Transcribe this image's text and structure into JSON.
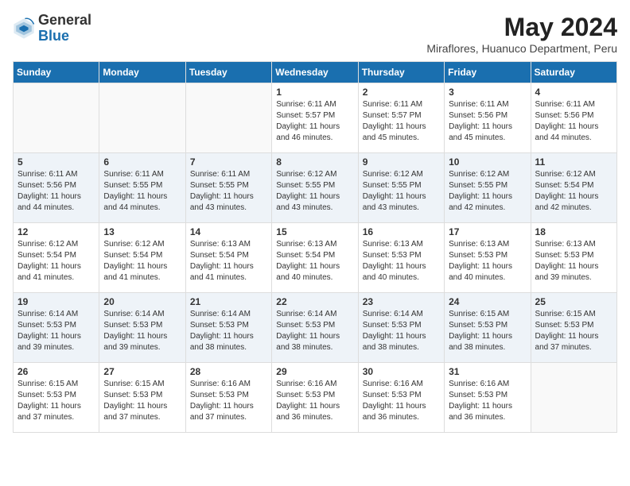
{
  "header": {
    "logo_general": "General",
    "logo_blue": "Blue",
    "month_year": "May 2024",
    "location": "Miraflores, Huanuco Department, Peru"
  },
  "days_of_week": [
    "Sunday",
    "Monday",
    "Tuesday",
    "Wednesday",
    "Thursday",
    "Friday",
    "Saturday"
  ],
  "weeks": [
    [
      {
        "day": "",
        "sunrise": "",
        "sunset": "",
        "daylight": ""
      },
      {
        "day": "",
        "sunrise": "",
        "sunset": "",
        "daylight": ""
      },
      {
        "day": "",
        "sunrise": "",
        "sunset": "",
        "daylight": ""
      },
      {
        "day": "1",
        "sunrise": "Sunrise: 6:11 AM",
        "sunset": "Sunset: 5:57 PM",
        "daylight": "Daylight: 11 hours and 46 minutes."
      },
      {
        "day": "2",
        "sunrise": "Sunrise: 6:11 AM",
        "sunset": "Sunset: 5:57 PM",
        "daylight": "Daylight: 11 hours and 45 minutes."
      },
      {
        "day": "3",
        "sunrise": "Sunrise: 6:11 AM",
        "sunset": "Sunset: 5:56 PM",
        "daylight": "Daylight: 11 hours and 45 minutes."
      },
      {
        "day": "4",
        "sunrise": "Sunrise: 6:11 AM",
        "sunset": "Sunset: 5:56 PM",
        "daylight": "Daylight: 11 hours and 44 minutes."
      }
    ],
    [
      {
        "day": "5",
        "sunrise": "Sunrise: 6:11 AM",
        "sunset": "Sunset: 5:56 PM",
        "daylight": "Daylight: 11 hours and 44 minutes."
      },
      {
        "day": "6",
        "sunrise": "Sunrise: 6:11 AM",
        "sunset": "Sunset: 5:55 PM",
        "daylight": "Daylight: 11 hours and 44 minutes."
      },
      {
        "day": "7",
        "sunrise": "Sunrise: 6:11 AM",
        "sunset": "Sunset: 5:55 PM",
        "daylight": "Daylight: 11 hours and 43 minutes."
      },
      {
        "day": "8",
        "sunrise": "Sunrise: 6:12 AM",
        "sunset": "Sunset: 5:55 PM",
        "daylight": "Daylight: 11 hours and 43 minutes."
      },
      {
        "day": "9",
        "sunrise": "Sunrise: 6:12 AM",
        "sunset": "Sunset: 5:55 PM",
        "daylight": "Daylight: 11 hours and 43 minutes."
      },
      {
        "day": "10",
        "sunrise": "Sunrise: 6:12 AM",
        "sunset": "Sunset: 5:55 PM",
        "daylight": "Daylight: 11 hours and 42 minutes."
      },
      {
        "day": "11",
        "sunrise": "Sunrise: 6:12 AM",
        "sunset": "Sunset: 5:54 PM",
        "daylight": "Daylight: 11 hours and 42 minutes."
      }
    ],
    [
      {
        "day": "12",
        "sunrise": "Sunrise: 6:12 AM",
        "sunset": "Sunset: 5:54 PM",
        "daylight": "Daylight: 11 hours and 41 minutes."
      },
      {
        "day": "13",
        "sunrise": "Sunrise: 6:12 AM",
        "sunset": "Sunset: 5:54 PM",
        "daylight": "Daylight: 11 hours and 41 minutes."
      },
      {
        "day": "14",
        "sunrise": "Sunrise: 6:13 AM",
        "sunset": "Sunset: 5:54 PM",
        "daylight": "Daylight: 11 hours and 41 minutes."
      },
      {
        "day": "15",
        "sunrise": "Sunrise: 6:13 AM",
        "sunset": "Sunset: 5:54 PM",
        "daylight": "Daylight: 11 hours and 40 minutes."
      },
      {
        "day": "16",
        "sunrise": "Sunrise: 6:13 AM",
        "sunset": "Sunset: 5:53 PM",
        "daylight": "Daylight: 11 hours and 40 minutes."
      },
      {
        "day": "17",
        "sunrise": "Sunrise: 6:13 AM",
        "sunset": "Sunset: 5:53 PM",
        "daylight": "Daylight: 11 hours and 40 minutes."
      },
      {
        "day": "18",
        "sunrise": "Sunrise: 6:13 AM",
        "sunset": "Sunset: 5:53 PM",
        "daylight": "Daylight: 11 hours and 39 minutes."
      }
    ],
    [
      {
        "day": "19",
        "sunrise": "Sunrise: 6:14 AM",
        "sunset": "Sunset: 5:53 PM",
        "daylight": "Daylight: 11 hours and 39 minutes."
      },
      {
        "day": "20",
        "sunrise": "Sunrise: 6:14 AM",
        "sunset": "Sunset: 5:53 PM",
        "daylight": "Daylight: 11 hours and 39 minutes."
      },
      {
        "day": "21",
        "sunrise": "Sunrise: 6:14 AM",
        "sunset": "Sunset: 5:53 PM",
        "daylight": "Daylight: 11 hours and 38 minutes."
      },
      {
        "day": "22",
        "sunrise": "Sunrise: 6:14 AM",
        "sunset": "Sunset: 5:53 PM",
        "daylight": "Daylight: 11 hours and 38 minutes."
      },
      {
        "day": "23",
        "sunrise": "Sunrise: 6:14 AM",
        "sunset": "Sunset: 5:53 PM",
        "daylight": "Daylight: 11 hours and 38 minutes."
      },
      {
        "day": "24",
        "sunrise": "Sunrise: 6:15 AM",
        "sunset": "Sunset: 5:53 PM",
        "daylight": "Daylight: 11 hours and 38 minutes."
      },
      {
        "day": "25",
        "sunrise": "Sunrise: 6:15 AM",
        "sunset": "Sunset: 5:53 PM",
        "daylight": "Daylight: 11 hours and 37 minutes."
      }
    ],
    [
      {
        "day": "26",
        "sunrise": "Sunrise: 6:15 AM",
        "sunset": "Sunset: 5:53 PM",
        "daylight": "Daylight: 11 hours and 37 minutes."
      },
      {
        "day": "27",
        "sunrise": "Sunrise: 6:15 AM",
        "sunset": "Sunset: 5:53 PM",
        "daylight": "Daylight: 11 hours and 37 minutes."
      },
      {
        "day": "28",
        "sunrise": "Sunrise: 6:16 AM",
        "sunset": "Sunset: 5:53 PM",
        "daylight": "Daylight: 11 hours and 37 minutes."
      },
      {
        "day": "29",
        "sunrise": "Sunrise: 6:16 AM",
        "sunset": "Sunset: 5:53 PM",
        "daylight": "Daylight: 11 hours and 36 minutes."
      },
      {
        "day": "30",
        "sunrise": "Sunrise: 6:16 AM",
        "sunset": "Sunset: 5:53 PM",
        "daylight": "Daylight: 11 hours and 36 minutes."
      },
      {
        "day": "31",
        "sunrise": "Sunrise: 6:16 AM",
        "sunset": "Sunset: 5:53 PM",
        "daylight": "Daylight: 11 hours and 36 minutes."
      },
      {
        "day": "",
        "sunrise": "",
        "sunset": "",
        "daylight": ""
      }
    ]
  ]
}
